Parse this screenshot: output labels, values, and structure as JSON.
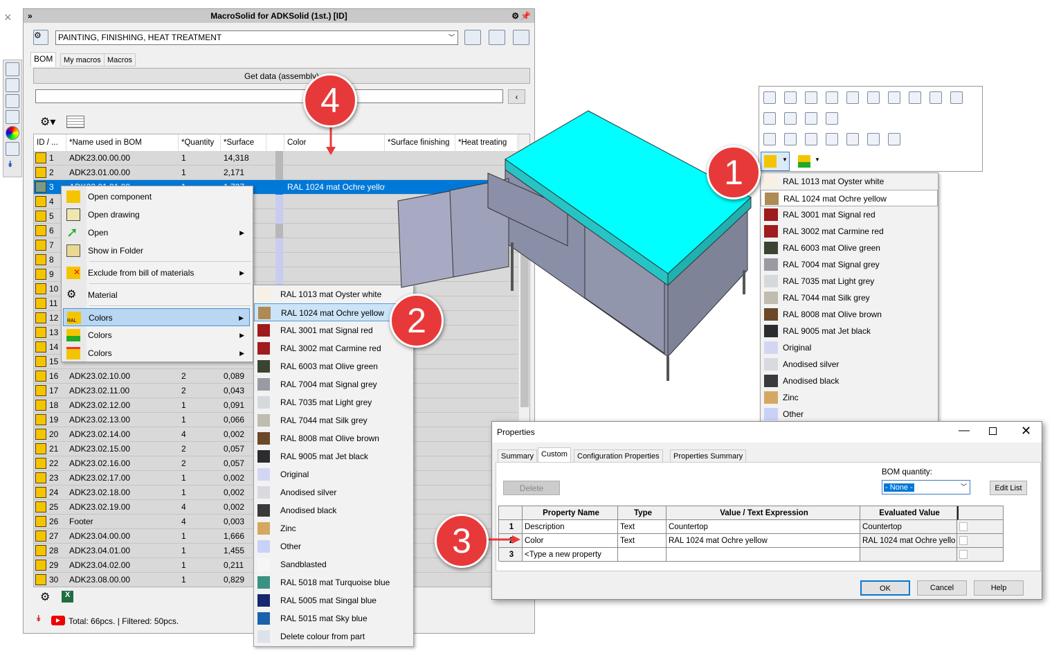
{
  "window": {
    "close": "×",
    "title": "MacroSolid for ADKSolid (1st.) [ID]",
    "collapse": "»"
  },
  "toolbar": {
    "category": "PAINTING, FINISHING, HEAT TREATMENT"
  },
  "tabs": [
    "BOM",
    "My macros",
    "Macros"
  ],
  "get_data": "Get data (assembly)",
  "filter_input": "",
  "columns": [
    "ID / ...",
    "*Name used in BOM",
    "*Quantity",
    "*Surface",
    "",
    "Color",
    "*Surface finishing",
    "*Heat treating"
  ],
  "rows": [
    {
      "id": "1",
      "name": "ADK23.00.00.00",
      "qty": "1",
      "surface": "14,318",
      "color": ""
    },
    {
      "id": "2",
      "name": "ADK23.01.00.00",
      "qty": "1",
      "surface": "2,171",
      "color": ""
    },
    {
      "id": "3",
      "name": "ADK23.01.01.00",
      "qty": "1",
      "surface": "1,727",
      "color": "RAL 1024 mat Ochre yellow"
    },
    {
      "id": "4",
      "name": "",
      "qty": "",
      "surface": "",
      "color": ""
    },
    {
      "id": "5",
      "name": "",
      "qty": "",
      "surface": "",
      "color": ""
    },
    {
      "id": "6",
      "name": "",
      "qty": "",
      "surface": "",
      "color": ""
    },
    {
      "id": "7",
      "name": "",
      "qty": "",
      "surface": "",
      "color": ""
    },
    {
      "id": "8",
      "name": "",
      "qty": "",
      "surface": "",
      "color": ""
    },
    {
      "id": "9",
      "name": "",
      "qty": "",
      "surface": "",
      "color": ""
    },
    {
      "id": "10",
      "name": "",
      "qty": "",
      "surface": "",
      "color": ""
    },
    {
      "id": "11",
      "name": "",
      "qty": "",
      "surface": "",
      "color": ""
    },
    {
      "id": "12",
      "name": "",
      "qty": "",
      "surface": "",
      "color": ""
    },
    {
      "id": "13",
      "name": "",
      "qty": "",
      "surface": "",
      "color": ""
    },
    {
      "id": "14",
      "name": "",
      "qty": "",
      "surface": "",
      "color": ""
    },
    {
      "id": "15",
      "name": "",
      "qty": "",
      "surface": "",
      "color": ""
    },
    {
      "id": "16",
      "name": "ADK23.02.10.00",
      "qty": "2",
      "surface": "0,089",
      "color": ""
    },
    {
      "id": "17",
      "name": "ADK23.02.11.00",
      "qty": "2",
      "surface": "0,043",
      "color": ""
    },
    {
      "id": "18",
      "name": "ADK23.02.12.00",
      "qty": "1",
      "surface": "0,091",
      "color": ""
    },
    {
      "id": "19",
      "name": "ADK23.02.13.00",
      "qty": "1",
      "surface": "0,066",
      "color": ""
    },
    {
      "id": "20",
      "name": "ADK23.02.14.00",
      "qty": "4",
      "surface": "0,002",
      "color": ""
    },
    {
      "id": "21",
      "name": "ADK23.02.15.00",
      "qty": "2",
      "surface": "0,057",
      "color": ""
    },
    {
      "id": "22",
      "name": "ADK23.02.16.00",
      "qty": "2",
      "surface": "0,057",
      "color": ""
    },
    {
      "id": "23",
      "name": "ADK23.02.17.00",
      "qty": "1",
      "surface": "0,002",
      "color": ""
    },
    {
      "id": "24",
      "name": "ADK23.02.18.00",
      "qty": "1",
      "surface": "0,002",
      "color": ""
    },
    {
      "id": "25",
      "name": "ADK23.02.19.00",
      "qty": "4",
      "surface": "0,002",
      "color": ""
    },
    {
      "id": "26",
      "name": "Footer",
      "qty": "4",
      "surface": "0,003",
      "color": ""
    },
    {
      "id": "27",
      "name": "ADK23.04.00.00",
      "qty": "1",
      "surface": "1,666",
      "color": ""
    },
    {
      "id": "28",
      "name": "ADK23.04.01.00",
      "qty": "1",
      "surface": "1,455",
      "color": ""
    },
    {
      "id": "29",
      "name": "ADK23.04.02.00",
      "qty": "1",
      "surface": "0,211",
      "color": ""
    },
    {
      "id": "30",
      "name": "ADK23.08.00.00",
      "qty": "1",
      "surface": "0,829",
      "color": ""
    }
  ],
  "status": "Total: 66pcs. | Filtered: 50pcs.",
  "context_menu": [
    "Open component",
    "Open drawing",
    "Open",
    "Show in Folder",
    "Exclude from bill of materials",
    "Material",
    "Colors",
    "Colors",
    "Colors"
  ],
  "colors_submenu": [
    {
      "label": "RAL 1013 mat Oyster white",
      "color": "#f8f1e3"
    },
    {
      "label": "RAL 1024 mat Ochre yellow",
      "color": "#ae8a55"
    },
    {
      "label": "RAL 3001 mat Signal red",
      "color": "#9e1a1c"
    },
    {
      "label": "RAL 3002 mat Carmine red",
      "color": "#a01c1e"
    },
    {
      "label": "RAL 6003 mat Olive green",
      "color": "#3b4431"
    },
    {
      "label": "RAL 7004 mat Signal grey",
      "color": "#9a9aa2"
    },
    {
      "label": "RAL 7035 mat Light grey",
      "color": "#d6d9dc"
    },
    {
      "label": "RAL 7044 mat Silk grey",
      "color": "#c1bcb0"
    },
    {
      "label": "RAL 8008 mat Olive brown",
      "color": "#6c4828"
    },
    {
      "label": "RAL 9005 mat Jet black",
      "color": "#2c2c2e"
    },
    {
      "label": "Original",
      "color": "#d2d6f2"
    },
    {
      "label": "Anodised silver",
      "color": "#d9d9e0"
    },
    {
      "label": "Anodised black",
      "color": "#3a3a3c"
    },
    {
      "label": "Zinc",
      "color": "#d4a862"
    },
    {
      "label": "Other",
      "color": "#c9d1f8"
    },
    {
      "label": "Sandblasted",
      "color": "#f6f6f6"
    },
    {
      "label": "RAL 5018 mat Turquoise blue",
      "color": "#3a9382"
    },
    {
      "label": "RAL 5005 mat Singal blue",
      "color": "#14286e"
    },
    {
      "label": "RAL 5015 mat Sky blue",
      "color": "#1a62aa"
    },
    {
      "label": "Delete colour from part",
      "color": "#dde2ea"
    }
  ],
  "properties": {
    "title": "Properties",
    "tabs": [
      "Summary",
      "Custom",
      "Configuration Properties",
      "Properties Summary"
    ],
    "delete": "Delete",
    "bom_label": "BOM quantity:",
    "bom_value": "- None -",
    "edit_list": "Edit List",
    "headers": [
      "Property Name",
      "Type",
      "Value / Text Expression",
      "Evaluated Value"
    ],
    "rows": [
      {
        "n": "1",
        "name": "Description",
        "type": "Text",
        "value": "Countertop",
        "eval": "Countertop"
      },
      {
        "n": "2",
        "name": "Color",
        "type": "Text",
        "value": "RAL 1024 mat Ochre yellow",
        "eval": "RAL 1024 mat Ochre yello"
      },
      {
        "n": "3",
        "name": "<Type a new property",
        "type": "",
        "value": "",
        "eval": ""
      }
    ],
    "ok": "OK",
    "cancel": "Cancel",
    "help": "Help"
  },
  "callouts": [
    "1",
    "2",
    "3",
    "4"
  ],
  "accent": "#0078d7"
}
